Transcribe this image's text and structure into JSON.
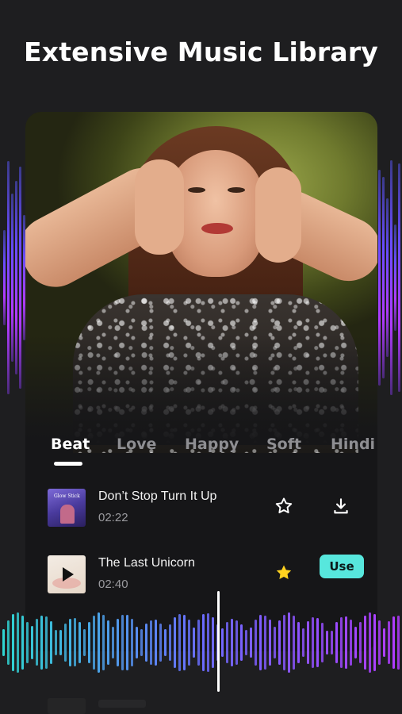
{
  "headline": "Extensive Music Library",
  "tabs": [
    {
      "label": "Beat",
      "active": true
    },
    {
      "label": "Love",
      "active": false
    },
    {
      "label": "Happy",
      "active": false
    },
    {
      "label": "Soft",
      "active": false
    },
    {
      "label": "Hindi",
      "active": false
    }
  ],
  "tracks": [
    {
      "title": "Don’t Stop Turn It Up",
      "duration": "02:22",
      "cover_text": "Glow Stick",
      "favorite": false,
      "action": "download-icon"
    },
    {
      "title": "The Last Unicorn",
      "duration": "02:40",
      "favorite": true,
      "action_label": "Use"
    }
  ],
  "colors": {
    "background": "#1e1e20",
    "accent_teal": "#57e7dd",
    "star_active": "#ffd21f",
    "wave_start": "#2fd4d0",
    "wave_mid": "#6a6cff",
    "wave_end": "#b23bff"
  },
  "icons": [
    "star-outline-icon",
    "download-icon",
    "star-filled-icon",
    "play-icon"
  ]
}
